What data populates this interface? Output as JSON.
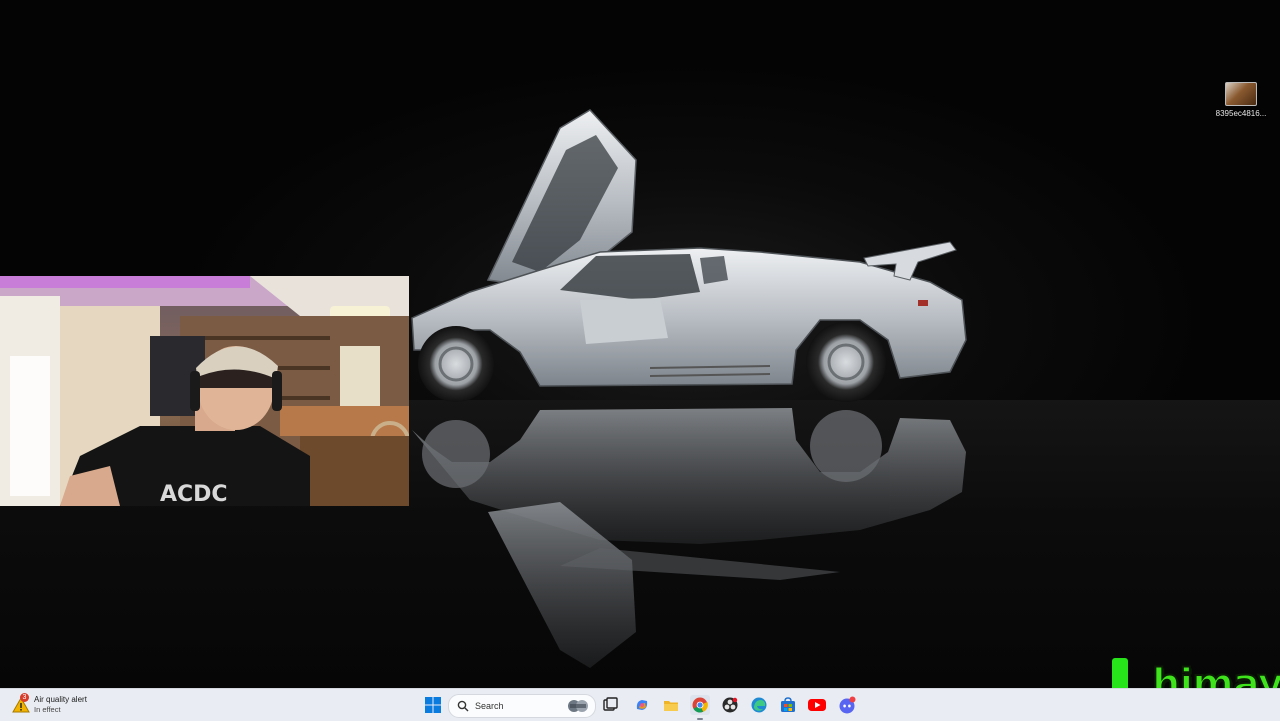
{
  "desktop": {
    "icons": [
      {
        "label": "8395ec4816..."
      }
    ],
    "wallpaper": "silver-wrecked-sports-car-on-dark-reflective-floor"
  },
  "overlay": {
    "webcam": "streamer-webcam-feed",
    "logo_text": "himay",
    "logo_color": "#3ee31c"
  },
  "taskbar": {
    "weather": {
      "badge": "3",
      "title": "Air quality alert",
      "subtitle": "In effect"
    },
    "search_placeholder": "Search",
    "apps": [
      {
        "name": "start-icon"
      },
      {
        "name": "task-view-icon"
      },
      {
        "name": "copilot-icon"
      },
      {
        "name": "file-explorer-icon"
      },
      {
        "name": "chrome-icon"
      },
      {
        "name": "obs-icon"
      },
      {
        "name": "edge-icon"
      },
      {
        "name": "store-icon"
      },
      {
        "name": "youtube-icon"
      },
      {
        "name": "discord-icon"
      }
    ],
    "accent": "#0067c0"
  }
}
